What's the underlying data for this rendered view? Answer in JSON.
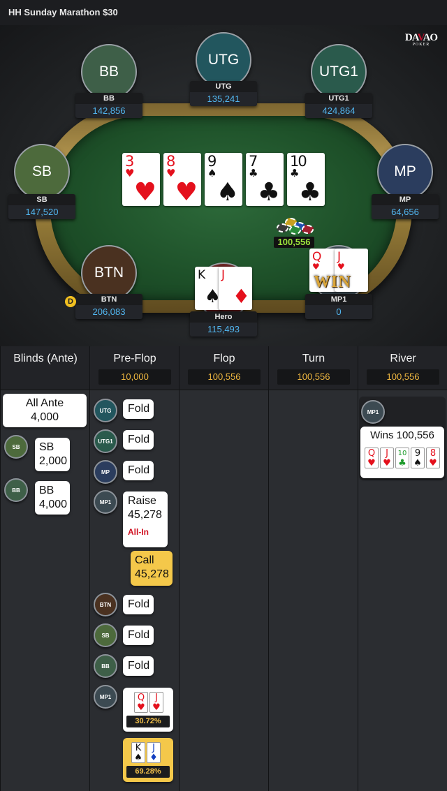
{
  "topbar": {
    "title": "HH  Sunday Marathon $30"
  },
  "logo": {
    "line1_a": "DA",
    "line1_b": "V",
    "line1_c": "AO",
    "line2": "POKER"
  },
  "colors": {
    "accent_blue": "#52b6f0",
    "pot_green": "#9be33c",
    "bet_yellow": "#f4c84a",
    "felt": "#1d4f28"
  },
  "seats": [
    {
      "id": "bb",
      "label": "BB",
      "name": "BB",
      "stack": "142,856",
      "color": "#3e5f48"
    },
    {
      "id": "utg",
      "label": "UTG",
      "name": "UTG",
      "stack": "135,241",
      "color": "#22565e"
    },
    {
      "id": "utg1",
      "label": "UTG1",
      "name": "UTG1",
      "stack": "424,864",
      "color": "#2a5a4c"
    },
    {
      "id": "sb",
      "label": "SB",
      "name": "SB",
      "stack": "147,520",
      "color": "#4d6a3c"
    },
    {
      "id": "mp",
      "label": "MP",
      "name": "MP",
      "stack": "64,656",
      "color": "#2b3d5e"
    },
    {
      "id": "btn",
      "label": "BTN",
      "name": "BTN",
      "stack": "206,083",
      "color": "#4a3120"
    },
    {
      "id": "hero",
      "label": "",
      "name": "Hero",
      "stack": "115,493",
      "color": "#6a2323"
    },
    {
      "id": "mp1",
      "label": "",
      "name": "MP1",
      "stack": "0",
      "color": "#3c4a52"
    }
  ],
  "board": [
    {
      "rank": "3",
      "suit": "♥",
      "color": "red"
    },
    {
      "rank": "8",
      "suit": "♥",
      "color": "red"
    },
    {
      "rank": "9",
      "suit": "♠",
      "color": "blk"
    },
    {
      "rank": "7",
      "suit": "♣",
      "color": "blk"
    },
    {
      "rank": "10",
      "suit": "♣",
      "color": "blk"
    }
  ],
  "hero_cards": [
    {
      "rank": "K",
      "suit": "♠",
      "color": "blk"
    },
    {
      "rank": "J",
      "suit": "♦",
      "color": "red"
    }
  ],
  "mp1_cards": [
    {
      "rank": "Q",
      "suit": "♥",
      "color": "red"
    },
    {
      "rank": "J",
      "suit": "♥",
      "color": "red"
    }
  ],
  "win_text": "WIN",
  "pot": "100,556",
  "dealer_label": "D",
  "streets": [
    {
      "title": "Blinds (Ante)",
      "pot": ""
    },
    {
      "title": "Pre-Flop",
      "pot": "10,000"
    },
    {
      "title": "Flop",
      "pot": "100,556"
    },
    {
      "title": "Turn",
      "pot": "100,556"
    },
    {
      "title": "River",
      "pot": "100,556"
    }
  ],
  "blinds": {
    "ante_l1": "All Ante",
    "ante_l2": "4,000",
    "sb_l1": "SB",
    "sb_l2": "2,000",
    "sb_badge": "SB",
    "bb_l1": "BB",
    "bb_l2": "4,000",
    "bb_badge": "BB"
  },
  "preflop": {
    "a1": {
      "badge": "UTG",
      "text": "Fold"
    },
    "a2": {
      "badge": "UTG1",
      "text": "Fold"
    },
    "a3": {
      "badge": "MP",
      "text": "Fold"
    },
    "a4": {
      "badge": "MP1",
      "l1": "Raise",
      "l2": "45,278",
      "tag": "All-In"
    },
    "a5": {
      "l1": "Call",
      "l2": "45,278"
    },
    "a6": {
      "badge": "BTN",
      "text": "Fold"
    },
    "a7": {
      "badge": "SB",
      "text": "Fold"
    },
    "a8": {
      "badge": "BB",
      "text": "Fold"
    },
    "show1": {
      "badge": "MP1",
      "equity": "30.72%"
    },
    "show2": {
      "equity": "69.28%"
    }
  },
  "river": {
    "badge": "MP1",
    "wins": "Wins 100,556",
    "cards": [
      {
        "rank": "Q",
        "suit": "♥",
        "color": "red"
      },
      {
        "rank": "J",
        "suit": "♥",
        "color": "red"
      },
      {
        "rank": "10",
        "suit": "♣",
        "color": "grn"
      },
      {
        "rank": "9",
        "suit": "♠",
        "color": "blk"
      },
      {
        "rank": "8",
        "suit": "♥",
        "color": "red"
      }
    ]
  },
  "mini_hands": {
    "mp1": [
      {
        "rank": "Q",
        "suit": "♥",
        "color": "red"
      },
      {
        "rank": "J",
        "suit": "♥",
        "color": "red"
      }
    ],
    "hero": [
      {
        "rank": "K",
        "suit": "♠",
        "color": "blk"
      },
      {
        "rank": "J",
        "suit": "♦",
        "color": "blu"
      }
    ]
  }
}
